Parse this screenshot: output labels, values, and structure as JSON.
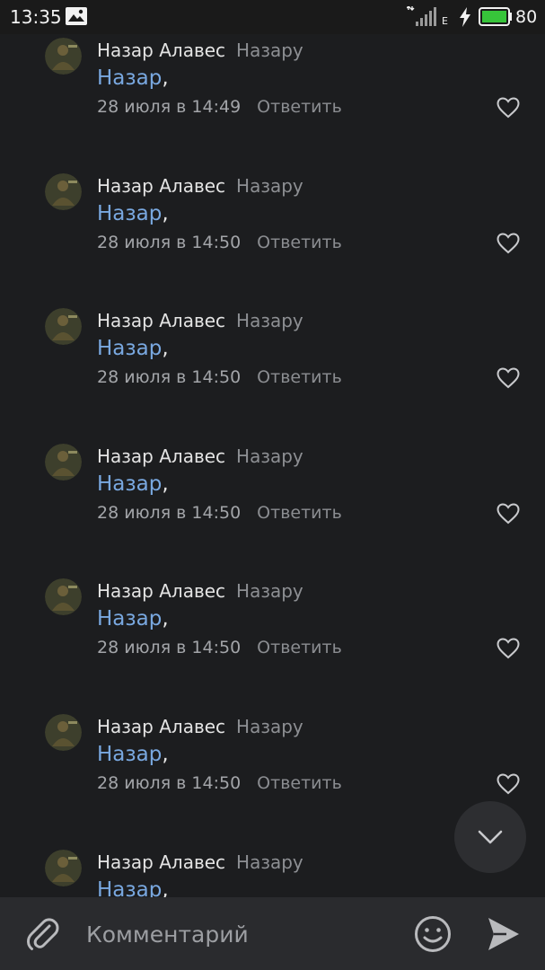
{
  "status_bar": {
    "time": "13:35",
    "network": "E",
    "battery": "80",
    "icons": [
      "image-icon",
      "signal-icon",
      "charging-icon",
      "battery-icon"
    ]
  },
  "comments": [
    {
      "author": "Назар Алавес",
      "reply_to": "Назару",
      "mention": "Назар",
      "comma": ",",
      "date": "28 июля в 14:49",
      "reply_label": "Ответить"
    },
    {
      "author": "Назар Алавес",
      "reply_to": "Назару",
      "mention": "Назар",
      "comma": ",",
      "date": "28 июля в 14:50",
      "reply_label": "Ответить"
    },
    {
      "author": "Назар Алавес",
      "reply_to": "Назару",
      "mention": "Назар",
      "comma": ",",
      "date": "28 июля в 14:50",
      "reply_label": "Ответить"
    },
    {
      "author": "Назар Алавес",
      "reply_to": "Назару",
      "mention": "Назар",
      "comma": ",",
      "date": "28 июля в 14:50",
      "reply_label": "Ответить"
    },
    {
      "author": "Назар Алавес",
      "reply_to": "Назару",
      "mention": "Назар",
      "comma": ",",
      "date": "28 июля в 14:50",
      "reply_label": "Ответить"
    },
    {
      "author": "Назар Алавес",
      "reply_to": "Назару",
      "mention": "Назар",
      "comma": ",",
      "date": "28 июля в 14:50",
      "reply_label": "Ответить"
    },
    {
      "author": "Назар Алавес",
      "reply_to": "Назару",
      "mention": "Назар",
      "comma": ",",
      "date": "",
      "reply_label": ""
    }
  ],
  "composer": {
    "placeholder": "Комментарий",
    "value": ""
  },
  "colors": {
    "background": "#1c1d1f",
    "mention": "#79a8e0",
    "battery": "#37c43a"
  }
}
